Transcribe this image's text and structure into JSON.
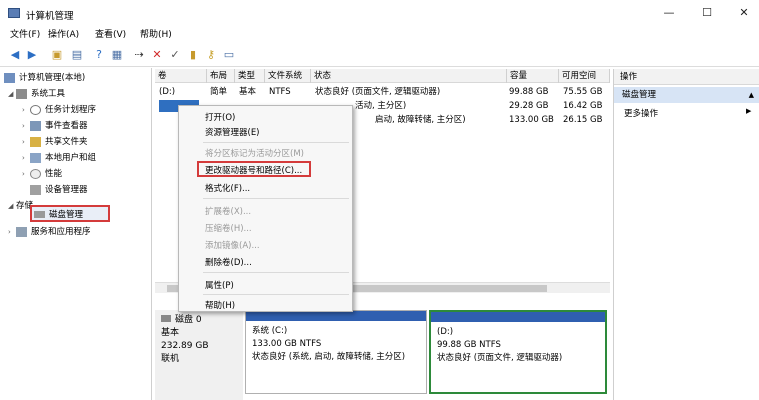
{
  "window": {
    "title": "计算机管理",
    "buttons": [
      "—",
      "☐",
      "✕"
    ]
  },
  "menu": [
    "文件(F)",
    "操作(A)",
    "查看(V)",
    "帮助(H)"
  ],
  "tree": {
    "items": [
      {
        "label": "计算机管理(本地)",
        "level": 0
      },
      {
        "label": "系统工具",
        "level": 1
      },
      {
        "label": "任务计划程序",
        "level": 2
      },
      {
        "label": "事件查看器",
        "level": 2
      },
      {
        "label": "共享文件夹",
        "level": 2
      },
      {
        "label": "本地用户和组",
        "level": 2
      },
      {
        "label": "性能",
        "level": 2
      },
      {
        "label": "设备管理器",
        "level": 2
      },
      {
        "label": "存储",
        "level": 1
      },
      {
        "label": "磁盘管理",
        "level": 2
      },
      {
        "label": "服务和应用程序",
        "level": 1
      }
    ]
  },
  "list": {
    "headers": [
      "卷",
      "布局",
      "类型",
      "文件系统",
      "状态",
      "容量",
      "可用空间"
    ],
    "rows": [
      [
        "(D:)",
        "简单",
        "基本",
        "NTFS",
        "状态良好 (页面文件, 逻辑驱动器)",
        "99.88 GB",
        "75.55 GB"
      ],
      [
        "",
        "",
        "",
        "",
        "活动, 主分区)",
        "29.28 GB",
        "16.42 GB"
      ],
      [
        "",
        "",
        "",
        "",
        "启动, 故障转储, 主分区)",
        "133.00 GB",
        "26.15 GB"
      ]
    ]
  },
  "context_menu": {
    "items": [
      {
        "label": "打开(O)",
        "disabled": false
      },
      {
        "label": "资源管理器(E)",
        "disabled": false
      },
      {
        "label": "将分区标记为活动分区(M)",
        "disabled": true
      },
      {
        "label": "更改驱动器号和路径(C)...",
        "disabled": false
      },
      {
        "label": "格式化(F)...",
        "disabled": false
      },
      {
        "label": "扩展卷(X)...",
        "disabled": true
      },
      {
        "label": "压缩卷(H)...",
        "disabled": true
      },
      {
        "label": "添加镜像(A)...",
        "disabled": true
      },
      {
        "label": "删除卷(D)...",
        "disabled": false
      },
      {
        "label": "属性(P)",
        "disabled": false
      },
      {
        "label": "帮助(H)",
        "disabled": false
      }
    ]
  },
  "actions": {
    "header": "操作",
    "section": "磁盘管理",
    "more": "更多操作"
  },
  "disk": {
    "label": "磁盘 0",
    "type": "基本",
    "size": "232.89 GB",
    "status": "联机",
    "partitions": [
      {
        "name": "系统 (C:)",
        "size": "133.00 GB NTFS",
        "status": "状态良好 (系统, 启动, 故障转储, 主分区)"
      },
      {
        "name": "(D:)",
        "size": "99.88 GB NTFS",
        "status": "状态良好 (页面文件, 逻辑驱动器)"
      }
    ]
  },
  "colors": {
    "highlight": "#d43b3b",
    "partition_bar": "#2f5fb0",
    "selected_partition": "#2d8a3a"
  }
}
